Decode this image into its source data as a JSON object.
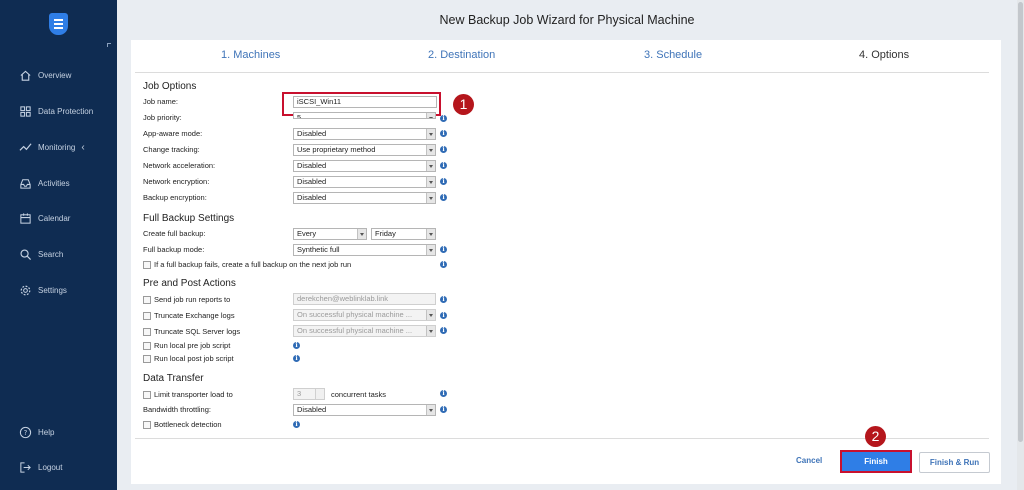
{
  "sidebar": {
    "items": [
      {
        "label": "Overview",
        "icon": "home-icon"
      },
      {
        "label": "Data Protection",
        "icon": "grid-icon"
      },
      {
        "label": "Monitoring",
        "icon": "pulse-icon"
      },
      {
        "label": "Activities",
        "icon": "inbox-icon"
      },
      {
        "label": "Calendar",
        "icon": "calendar-icon"
      },
      {
        "label": "Search",
        "icon": "search-icon"
      },
      {
        "label": "Settings",
        "icon": "gear-icon"
      }
    ],
    "help": "Help",
    "logout": "Logout"
  },
  "wizard": {
    "title": "New Backup Job Wizard for Physical Machine",
    "steps": [
      "1. Machines",
      "2. Destination",
      "3. Schedule",
      "4. Options"
    ],
    "active_step": "4. Options"
  },
  "job_options": {
    "title": "Job Options",
    "job_name_label": "Job name:",
    "job_name_value": "iSCSI_Win11",
    "job_priority_label": "Job priority:",
    "job_priority_value": "5",
    "app_aware_label": "App-aware mode:",
    "app_aware_value": "Disabled",
    "change_tracking_label": "Change tracking:",
    "change_tracking_value": "Use proprietary method",
    "net_accel_label": "Network acceleration:",
    "net_accel_value": "Disabled",
    "net_enc_label": "Network encryption:",
    "net_enc_value": "Disabled",
    "backup_enc_label": "Backup encryption:",
    "backup_enc_value": "Disabled"
  },
  "full_backup": {
    "title": "Full Backup Settings",
    "create_label": "Create full backup:",
    "create_value": "Every",
    "day_value": "Friday",
    "mode_label": "Full backup mode:",
    "mode_value": "Synthetic full",
    "fail_checkbox": "If a full backup fails, create a full backup on the next job run"
  },
  "pre_post": {
    "title": "Pre and Post Actions",
    "send_reports": "Send job run reports to",
    "send_reports_value": "derekchen@weblinklab.link",
    "truncate_exchange": "Truncate Exchange logs",
    "truncate_exchange_value": "On successful physical machine ...",
    "truncate_sql": "Truncate SQL Server logs",
    "truncate_sql_value": "On successful physical machine ...",
    "pre_script": "Run local pre job script",
    "post_script": "Run local post job script"
  },
  "data_transfer": {
    "title": "Data Transfer",
    "limit_load": "Limit transporter load to",
    "limit_value": "3",
    "concurrent": "concurrent tasks",
    "bandwidth_label": "Bandwidth throttling:",
    "bandwidth_value": "Disabled",
    "bottleneck": "Bottleneck detection"
  },
  "callouts": {
    "one": "1",
    "two": "2"
  },
  "footer": {
    "cancel": "Cancel",
    "finish": "Finish",
    "finish_run": "Finish & Run"
  },
  "colors": {
    "sidebar": "#0f2c52",
    "accent": "#2f7ee6",
    "link": "#3f74b8",
    "callout": "#c8102e"
  }
}
